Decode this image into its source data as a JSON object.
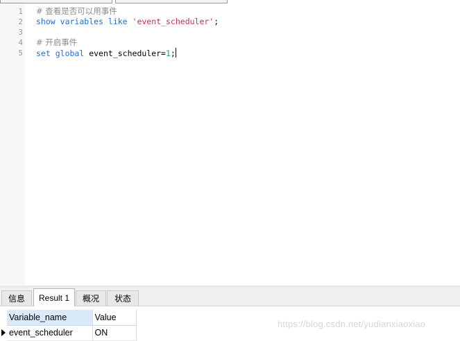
{
  "editor": {
    "lines": [
      {
        "number": "1",
        "comment": "# 查看是否可以用事件"
      },
      {
        "number": "2",
        "kw1": "show",
        "kw2": "variables",
        "kw3": "like",
        "str": "'event_scheduler'",
        "tail": ";"
      },
      {
        "number": "3"
      },
      {
        "number": "4",
        "comment": "# 开启事件"
      },
      {
        "number": "5",
        "kw1": "set",
        "kw2": "global",
        "plain": "event_scheduler=",
        "num": "1",
        "tail": ";"
      }
    ]
  },
  "result_tabs": [
    {
      "label": "信息"
    },
    {
      "label": "Result 1"
    },
    {
      "label": "概况"
    },
    {
      "label": "状态"
    }
  ],
  "result": {
    "columns": [
      "Variable_name",
      "Value"
    ],
    "rows": [
      [
        "event_scheduler",
        "ON"
      ]
    ]
  },
  "watermark": "https://blog.csdn.net/yudianxiaoxiao",
  "colors": {
    "keyword": "#1f6fd0",
    "string": "#c72a6e",
    "comment": "#8c8c8c",
    "number": "#1aa65a",
    "header_bg": "#dbeaf9"
  }
}
